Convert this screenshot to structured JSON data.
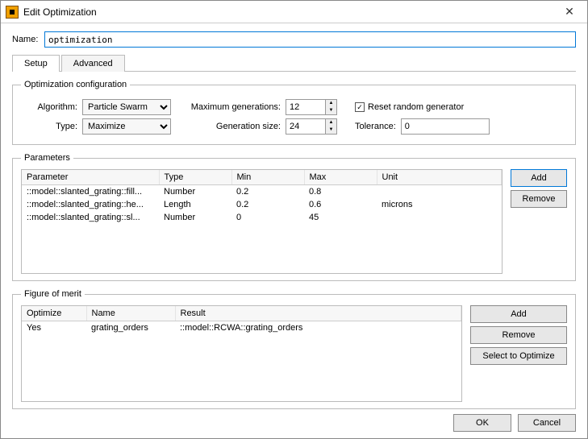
{
  "window": {
    "title": "Edit Optimization"
  },
  "name": {
    "label": "Name:",
    "value": "optimization"
  },
  "tabs": {
    "setup": "Setup",
    "advanced": "Advanced"
  },
  "cfg": {
    "legend": "Optimization configuration",
    "algorithm_label": "Algorithm:",
    "algorithm_value": "Particle Swarm",
    "maxgen_label": "Maximum generations:",
    "maxgen_value": "12",
    "reset_label": "Reset random generator",
    "reset_checked": true,
    "type_label": "Type:",
    "type_value": "Maximize",
    "gensize_label": "Generation size:",
    "gensize_value": "24",
    "tolerance_label": "Tolerance:",
    "tolerance_value": "0"
  },
  "params": {
    "legend": "Parameters",
    "cols": {
      "parameter": "Parameter",
      "type": "Type",
      "min": "Min",
      "max": "Max",
      "unit": "Unit"
    },
    "rows": [
      {
        "parameter": "::model::slanted_grating::fill...",
        "type": "Number",
        "min": "0.2",
        "max": "0.8",
        "unit": ""
      },
      {
        "parameter": "::model::slanted_grating::he...",
        "type": "Length",
        "min": "0.2",
        "max": "0.6",
        "unit": "microns"
      },
      {
        "parameter": "::model::slanted_grating::sl...",
        "type": "Number",
        "min": "0",
        "max": "45",
        "unit": ""
      }
    ],
    "add": "Add",
    "remove": "Remove"
  },
  "fom": {
    "legend": "Figure of merit",
    "cols": {
      "optimize": "Optimize",
      "name": "Name",
      "result": "Result"
    },
    "rows": [
      {
        "optimize": "Yes",
        "name": "grating_orders",
        "result": "::model::RCWA::grating_orders"
      }
    ],
    "add": "Add",
    "remove": "Remove",
    "select": "Select to Optimize"
  },
  "footer": {
    "ok": "OK",
    "cancel": "Cancel"
  }
}
